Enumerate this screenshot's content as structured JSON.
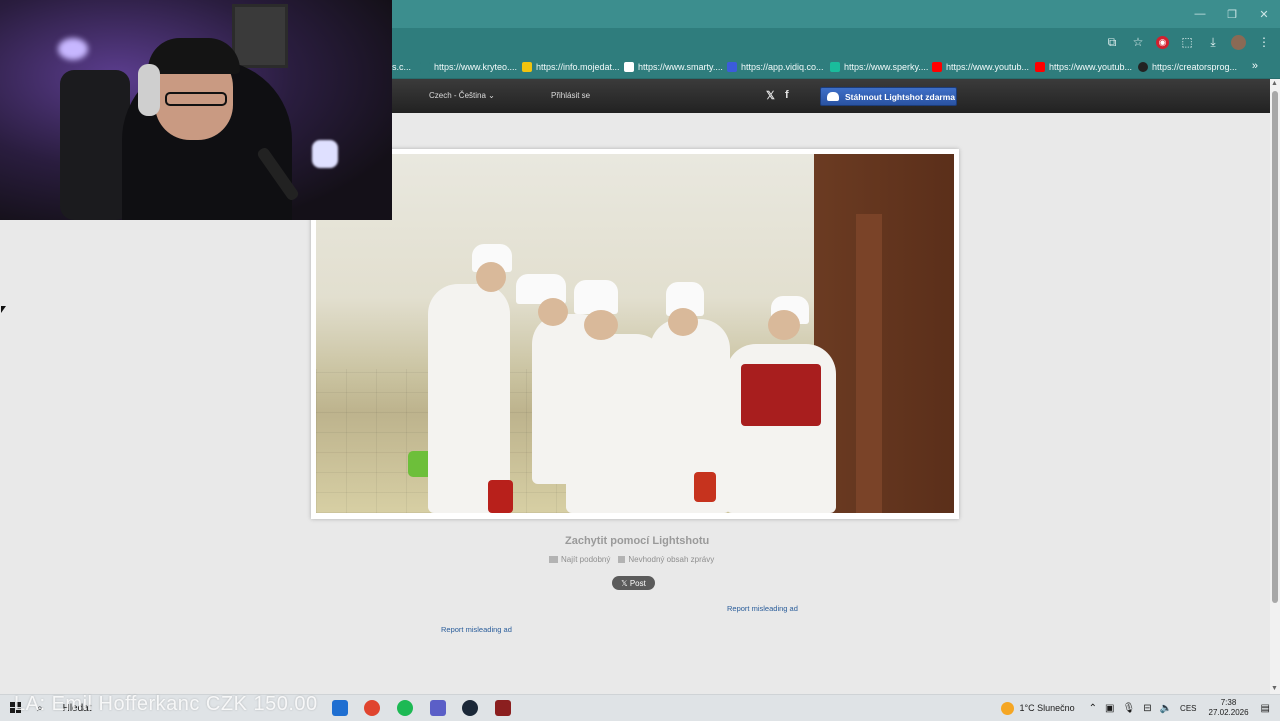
{
  "window": {
    "controls": [
      "—",
      "❐",
      "✕"
    ]
  },
  "toolbar": {
    "icons": [
      "install-icon",
      "star-icon",
      "opera-icon",
      "extensions-icon",
      "download-icon",
      "profile-icon",
      "menu-icon"
    ]
  },
  "bookmarks": [
    {
      "label": "s.c...",
      "favicon": "#4b4b4b"
    },
    {
      "label": "https://www.kryteo....",
      "favicon": "#2f7d7d"
    },
    {
      "label": "https://info.mojedat...",
      "favicon": "#f1c40f"
    },
    {
      "label": "https://www.smarty....",
      "favicon": "#ffffff"
    },
    {
      "label": "https://app.vidiq.co...",
      "favicon": "#3b5bdb"
    },
    {
      "label": "https://www.sperky....",
      "favicon": "#1abc9c"
    },
    {
      "label": "https://www.youtub...",
      "favicon": "#ff0000"
    },
    {
      "label": "https://www.youtub...",
      "favicon": "#ff0000"
    },
    {
      "label": "https://creatorsprog...",
      "favicon": "#222222"
    }
  ],
  "bookmarks_more": "»",
  "site_header": {
    "language": "Czech - Čeština ⌄",
    "login": "Přihlásit se",
    "twitter": "𝕏",
    "facebook": "f",
    "download_button": "Stáhnout Lightshot zdarma"
  },
  "below_image": {
    "caption": "Zachytit pomocí Lightshotu",
    "find_similar": "Najít podobný",
    "report_content": "Nevhodný obsah zprávy",
    "post_button": "𝕏 Post",
    "report_ad_1": "Report misleading ad",
    "report_ad_2": "Report misleading ad"
  },
  "taskbar": {
    "overlay_text": "LA: Emil Hofferkanc CZK 150.00",
    "search_label": "Hledat",
    "weather": "1°C  Slunečno",
    "language": "CES",
    "time": "7:38",
    "date": "27.02.2026",
    "apps": [
      {
        "name": "task-view-icon",
        "color": "#555555"
      },
      {
        "name": "store-icon",
        "color": "#1f6fd1"
      },
      {
        "name": "chrome-icon",
        "color": "#e0452f"
      },
      {
        "name": "spotify-icon",
        "color": "#1db954"
      },
      {
        "name": "teams-icon",
        "color": "#5b5fc7"
      },
      {
        "name": "steam-icon",
        "color": "#1b2838"
      },
      {
        "name": "app-icon",
        "color": "#8b1f1f"
      }
    ]
  }
}
